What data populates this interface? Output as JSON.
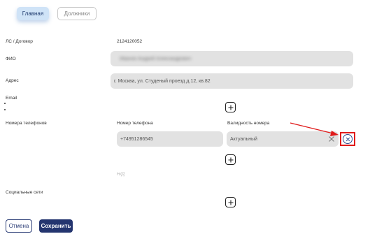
{
  "tabs": {
    "main": "Главная",
    "debtors": "Должники"
  },
  "account": {
    "label": "ЛС / Договор",
    "value": "2124120052"
  },
  "fio": {
    "label": "ФИО",
    "value": "Иванов Андрей Александрович"
  },
  "address": {
    "label": "Адрес",
    "value": "г. Москва, ул. Студеный проезд д.12, кв.82"
  },
  "email": {
    "label": "Email"
  },
  "phones": {
    "label": "Номера телефонов",
    "col_number": "Номер телефона",
    "col_validity": "Валидность номера",
    "number": "+74951286545",
    "validity": "Актуальный"
  },
  "na_text": "Н/Д",
  "social": {
    "label": "Социальные сети"
  },
  "actions": {
    "cancel": "Отмена",
    "save": "Сохранить"
  },
  "colors": {
    "accent": "#24356f",
    "highlight": "#e01b1b",
    "tab_active_bg": "#cfe3f7"
  },
  "icons": [
    "plus-icon",
    "clear-icon",
    "remove-circle-x-icon",
    "annotation-arrow"
  ]
}
